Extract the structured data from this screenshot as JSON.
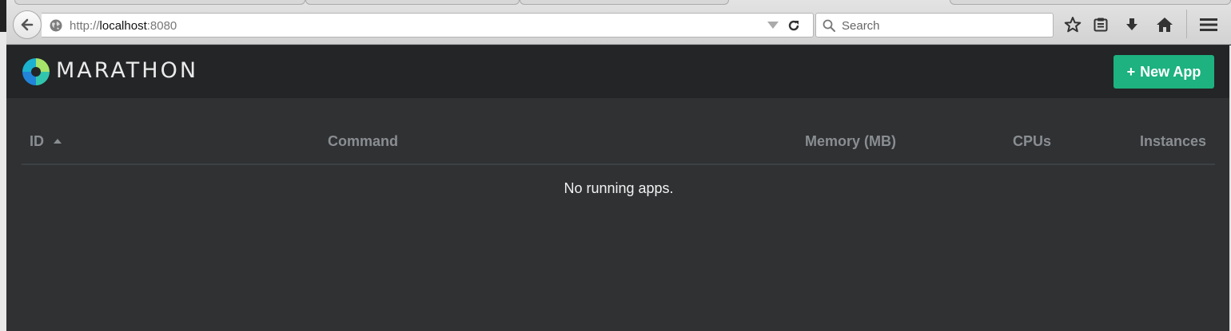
{
  "browser": {
    "url_prefix": "http://",
    "url_host": "localhost",
    "url_port": ":8080",
    "search_placeholder": "Search"
  },
  "app": {
    "brand": "MARATHON",
    "new_app_label": "New App",
    "new_app_plus": "+",
    "accent_color": "#1db27f"
  },
  "table": {
    "columns": [
      "ID",
      "Command",
      "Memory (MB)",
      "CPUs",
      "Instances"
    ],
    "sort_indicator": "ascending",
    "empty_message": "No running apps."
  }
}
